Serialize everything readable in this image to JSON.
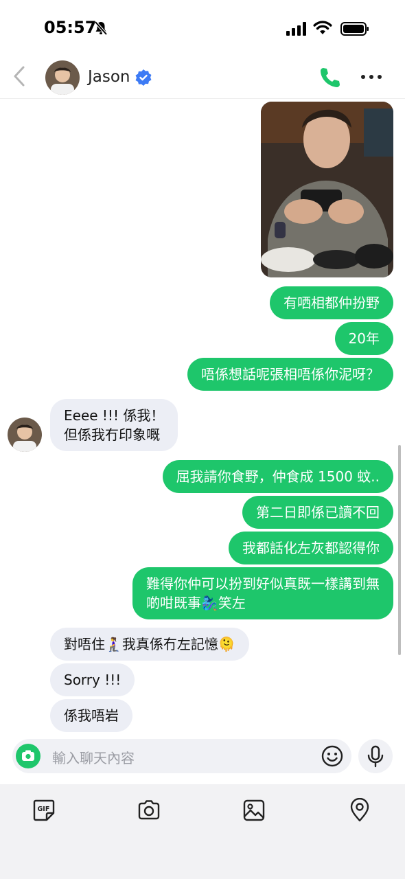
{
  "status": {
    "time": "05:57"
  },
  "header": {
    "contact_name": "Jason",
    "icons": [
      "back-arrow-icon",
      "verified-icon",
      "phone-icon",
      "more-icon"
    ],
    "accent_color": "#1ec66b",
    "verified_color": "#3d7bf5"
  },
  "messages": [
    {
      "type": "image",
      "from": "me",
      "description_icon": "photo-icon"
    },
    {
      "from": "me",
      "text": "有哂相都仲扮野"
    },
    {
      "from": "me",
      "text": "20年"
    },
    {
      "from": "me",
      "text": "唔係想話呢張相唔係你泥呀？"
    },
    {
      "from": "them",
      "text": "Eeee !!! 係我！\n但係我冇印象嘅"
    },
    {
      "from": "me",
      "text": "屈我請你食野，仲食成 1500 蚊.."
    },
    {
      "from": "me",
      "text": "第二日即係已讀不回"
    },
    {
      "from": "me",
      "text": "我都話化左灰都認得你"
    },
    {
      "from": "me",
      "text": "難得你仲可以扮到好似真既一樣講到無\n啲咁既事🧞‍♀️笑左"
    },
    {
      "from": "them",
      "text": "對唔住🧎‍♀️我真係冇左記憶🫠"
    },
    {
      "from": "them",
      "text": "Sorry !!!"
    },
    {
      "from": "them",
      "text": "係我唔岩"
    }
  ],
  "input": {
    "placeholder": "輸入聊天內容"
  },
  "toolbar": {
    "items": [
      "gif-icon",
      "camera-icon",
      "image-icon",
      "location-icon"
    ]
  }
}
